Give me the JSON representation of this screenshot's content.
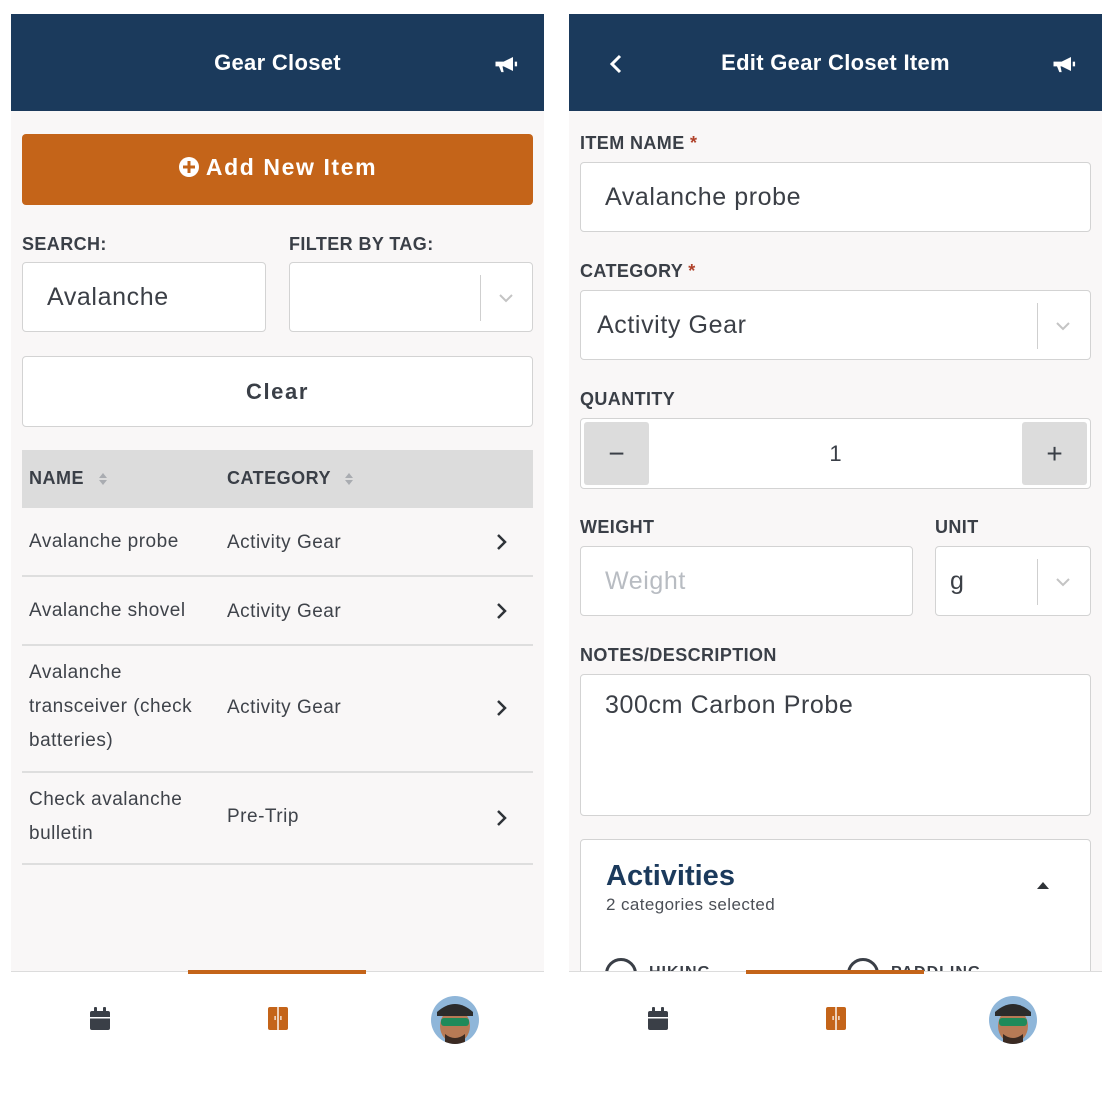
{
  "left": {
    "header": {
      "title": "Gear Closet",
      "icon": "megaphone-icon"
    },
    "add_button": {
      "label": "Add New Item",
      "icon": "plus-circle-icon"
    },
    "search": {
      "label": "SEARCH:",
      "value": "Avalanche"
    },
    "filter": {
      "label": "FILTER BY TAG:",
      "value": ""
    },
    "clear_button": {
      "label": "Clear"
    },
    "table": {
      "headers": {
        "name": "NAME",
        "category": "CATEGORY"
      },
      "rows": [
        {
          "name": "Avalanche probe",
          "category": "Activity Gear"
        },
        {
          "name": "Avalanche shovel",
          "category": "Activity Gear"
        },
        {
          "name": "Avalanche transceiver (check batteries)",
          "category": "Activity Gear"
        },
        {
          "name": "Check avalanche bulletin",
          "category": "Pre-Trip"
        }
      ]
    }
  },
  "right": {
    "header": {
      "title": "Edit Gear Closet Item",
      "back_icon": "chevron-left-icon",
      "icon": "megaphone-icon"
    },
    "item_name": {
      "label": "ITEM NAME",
      "required": "*",
      "value": "Avalanche probe"
    },
    "category": {
      "label": "CATEGORY",
      "required": "*",
      "value": "Activity Gear"
    },
    "quantity": {
      "label": "QUANTITY",
      "value": "1",
      "minus": "−",
      "plus": "+"
    },
    "weight": {
      "label": "WEIGHT",
      "placeholder": "Weight"
    },
    "unit": {
      "label": "UNIT",
      "value": "g"
    },
    "notes": {
      "label": "NOTES/DESCRIPTION",
      "value": "300cm Carbon Probe"
    },
    "activities": {
      "title": "Activities",
      "subtitle": "2 categories selected",
      "options": [
        "HIKING",
        "PADDLING"
      ]
    }
  },
  "tabbar": {
    "tabs": [
      "calendar-icon",
      "closet-icon",
      "avatar"
    ],
    "active": 1
  },
  "colors": {
    "header": "#1b3a5c",
    "accent": "#c46419",
    "background": "#f9f7f7"
  }
}
